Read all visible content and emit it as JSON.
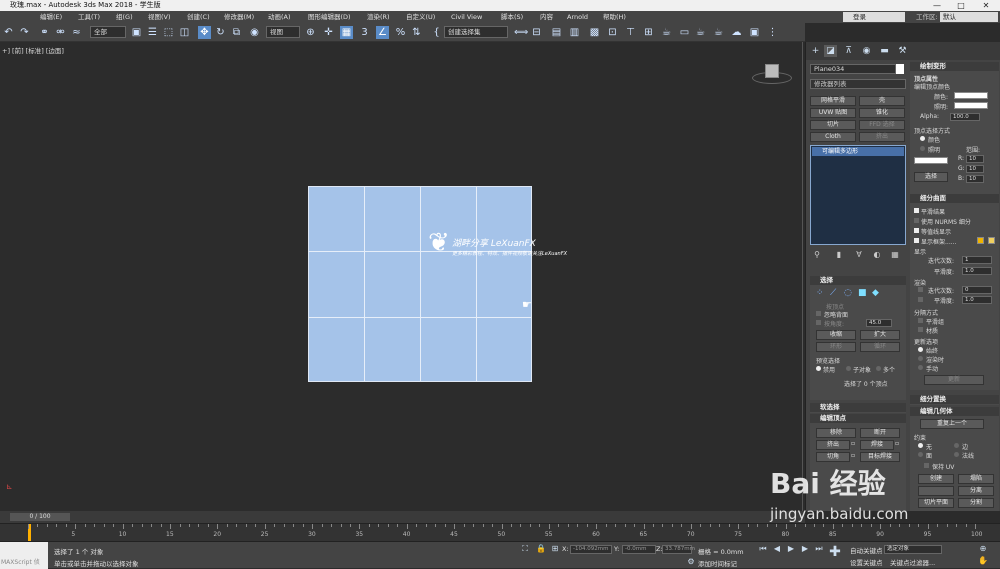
{
  "titlebar": {
    "title": "玫瑰.max - Autodesk 3ds Max 2018 - 学生版",
    "minimize": "—",
    "maximize": "□",
    "close": "✕"
  },
  "menu": [
    "编辑(E)",
    "工具(T)",
    "组(G)",
    "视图(V)",
    "创建(C)",
    "修改器(M)",
    "动画(A)",
    "图形编辑器(D)",
    "渲染(R)",
    "自定义(U)",
    "Civil View",
    "脚本(S)",
    "内容",
    "Arnold",
    "帮助(H)"
  ],
  "account": {
    "login": "登录",
    "workspace_label": "工作区:",
    "workspace_value": "默认"
  },
  "toolbar": {
    "filter": "全部",
    "view_dropdown": "视图",
    "selection_set": "创建选择集"
  },
  "viewport": {
    "label": "+] [前] [标准] [边面]"
  },
  "watermark": {
    "title": "湖畔分享 LeXuanFX",
    "subtitle": "更多精彩教程、特效、插件视频敬请关注LeXuanFX",
    "small": "LeXuanFX"
  },
  "cmdpanel": {
    "object_name": "Plane034",
    "modifier_list": "修改器列表",
    "mod_buttons": [
      {
        "label": "网格平滑",
        "enabled": true
      },
      {
        "label": "壳",
        "enabled": true
      },
      {
        "label": "UVW 贴图",
        "enabled": true
      },
      {
        "label": "锥化",
        "enabled": true
      },
      {
        "label": "切片",
        "enabled": true
      },
      {
        "label": "FFD 选择",
        "enabled": false
      },
      {
        "label": "Cloth",
        "enabled": true
      },
      {
        "label": "挤出",
        "enabled": false
      }
    ],
    "stack_item": "可编辑多边形"
  },
  "selection": {
    "title": "选择",
    "by_vertex": "按顶点",
    "ignore_back": "忽略背面",
    "by_angle": "按角度:",
    "angle_value": "45.0",
    "shrink": "收缩",
    "grow": "扩大",
    "ring": "环形",
    "loop": "循环",
    "preview_title": "预览选择",
    "preview_off": "禁用",
    "preview_sub": "子对象",
    "preview_multi": "多个",
    "status": "选择了 0 个顶点"
  },
  "soft_selection": {
    "title": "软选择"
  },
  "edit_vertices": {
    "title": "编辑顶点",
    "remove": "移除",
    "break": "断开",
    "extrude": "挤出",
    "weld": "焊接",
    "chamfer": "切角",
    "target_weld": "目标焊接"
  },
  "vertex_paint": {
    "title": "绘制变形",
    "vertex_attrs": "顶点属性",
    "edit_vertex_color": "编辑顶点颜色",
    "color_label": "颜色:",
    "illum_label": "照明:",
    "alpha_label": "Alpha:",
    "alpha_value": "100.0",
    "select_by": "顶点选择方式",
    "by_color": "颜色",
    "by_illum": "照明",
    "range": "范围:",
    "r": "R:",
    "g": "G:",
    "b": "B:",
    "r_val": "10",
    "g_val": "10",
    "b_val": "10",
    "select_btn": "选择"
  },
  "subdivision": {
    "title": "细分曲面",
    "smooth_result": "平滑结果",
    "use_nurms": "使用 NURMS 细分",
    "isoline": "等值线显示",
    "show_cage": "显示框架......",
    "display": "显示",
    "iterations": "迭代次数:",
    "iter_val": "1",
    "smoothness": "平滑度:",
    "smooth_val": "1.0",
    "render": "渲染",
    "r_iterations": "迭代次数:",
    "r_iter_val": "0",
    "r_smoothness": "平滑度:",
    "r_smooth_val": "1.0",
    "sep_title": "分隔方式",
    "smoothing_groups": "平滑组",
    "materials": "材质",
    "update_title": "更新选项",
    "always": "始终",
    "when_render": "渲染时",
    "manual": "手动",
    "update_btn": "更新"
  },
  "subdiv_displace": {
    "title": "细分置换"
  },
  "edit_geometry": {
    "title": "编辑几何体",
    "repeat_last": "重复上一个",
    "constraint": "约束",
    "none": "无",
    "edge": "边",
    "face": "面",
    "normal": "法线",
    "preserve_uv": "保持 UV",
    "create": "创建",
    "collapse": "塌陷",
    "detach": "分离",
    "slice_plane": "切片平面",
    "split": "分割"
  },
  "timeline": {
    "frame": "0 / 100",
    "ticks": [
      "5",
      "10",
      "15",
      "20",
      "25",
      "30",
      "35",
      "40",
      "45",
      "50",
      "55",
      "60",
      "65",
      "70",
      "75",
      "80",
      "85",
      "90",
      "95",
      "100"
    ]
  },
  "status": {
    "maxscript": "MAXScript 侦",
    "selected": "选择了 1 个 对象",
    "hint": "单击或单击并拖动以选择对象",
    "x_label": "X:",
    "x_val": "-104.092mm",
    "y_label": "Y:",
    "y_val": "-0.0mm",
    "z_label": "Z:",
    "z_val": "33.787mm",
    "grid": "栅格 = 0.0mm",
    "add_tag": "添加时间标记",
    "autokey": "自动关键点",
    "selected_obj": "选定对象",
    "set_key": "设置关键点",
    "key_filters": "关键点过滤器..."
  },
  "overlay": {
    "brand": "Bai 经验",
    "url": "jingyan.baidu.com"
  }
}
